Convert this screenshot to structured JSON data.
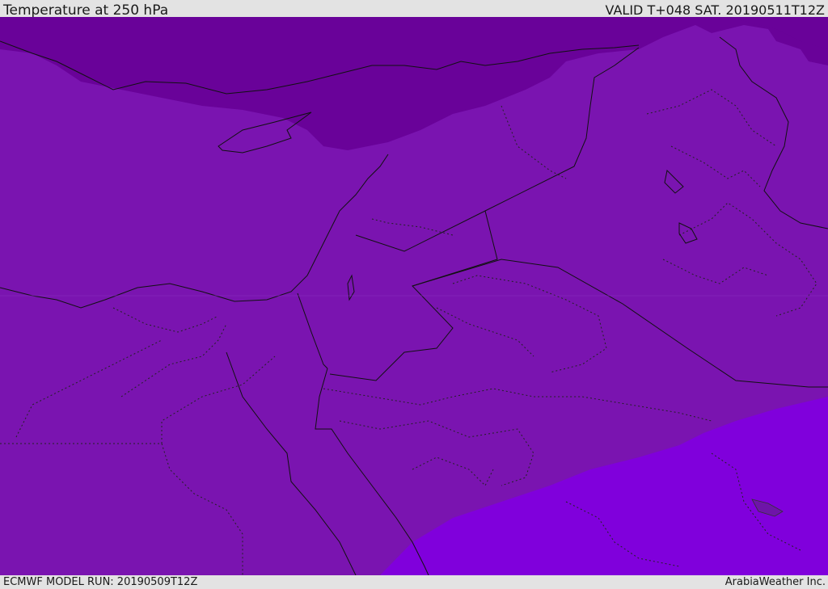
{
  "header": {
    "title": "Temperature at 250 hPa",
    "valid": "VALID T+048 SAT. 20190511T12Z"
  },
  "footer": {
    "model_run": "ECMWF MODEL RUN: 20190509T12Z",
    "credit": "ArabiaWeather Inc."
  },
  "map": {
    "colors": {
      "cold_band": "#690299",
      "mid_band": "#7a14b0",
      "warm_band": "#8000dc",
      "coastline": "#111111",
      "border": "#111111"
    }
  }
}
